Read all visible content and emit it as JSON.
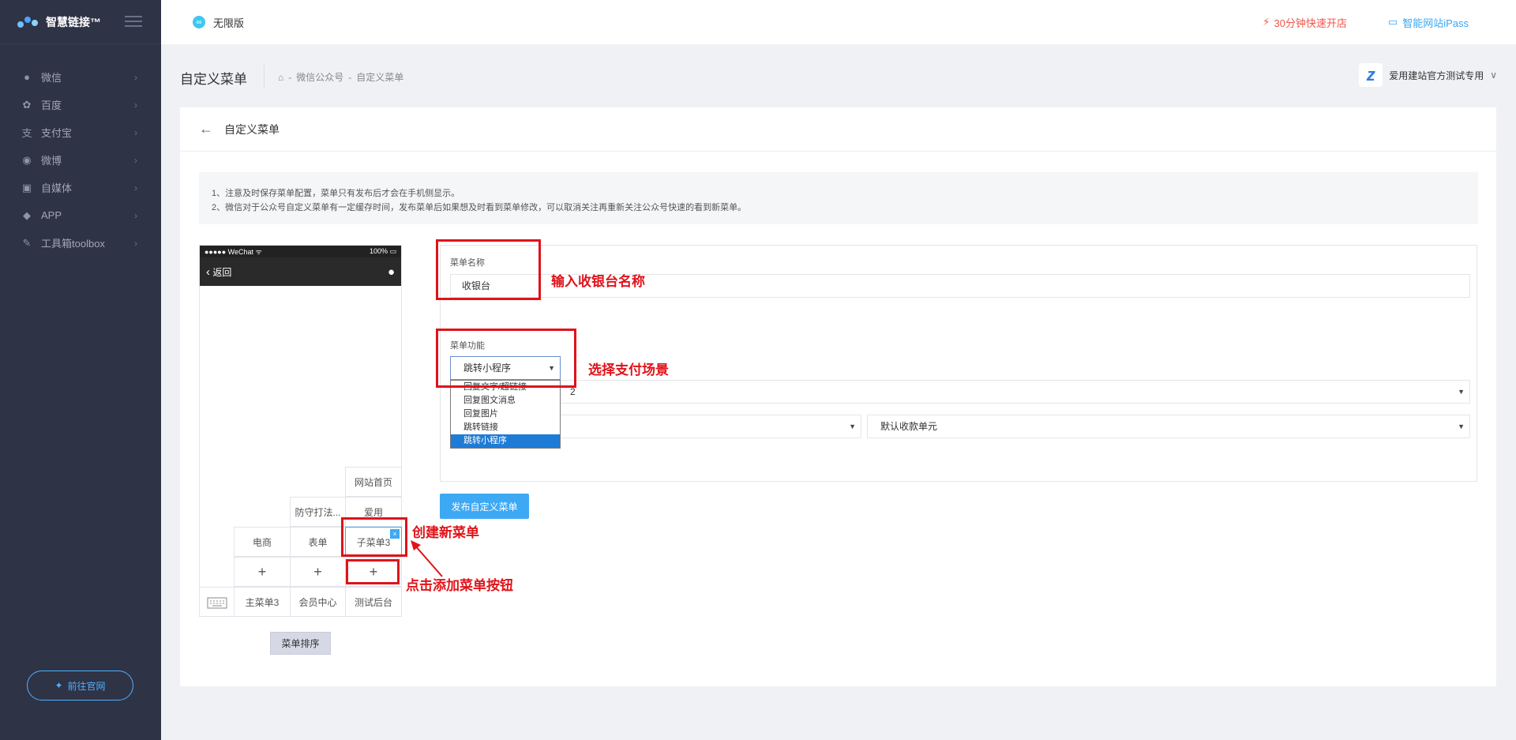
{
  "sidebar": {
    "logo_text": "智慧链接™",
    "items": [
      {
        "label": "微信",
        "icon": "wechat-icon",
        "glyph": "●"
      },
      {
        "label": "百度",
        "icon": "paw-icon",
        "glyph": "✿"
      },
      {
        "label": "支付宝",
        "icon": "alipay-icon",
        "glyph": "支"
      },
      {
        "label": "微博",
        "icon": "weibo-icon",
        "glyph": "◉"
      },
      {
        "label": "自媒体",
        "icon": "media-icon",
        "glyph": "▣"
      },
      {
        "label": "APP",
        "icon": "android-icon",
        "glyph": "◆"
      },
      {
        "label": "工具箱toolbox",
        "icon": "wrench-icon",
        "glyph": "✎"
      }
    ],
    "official_btn": "前往官网"
  },
  "topbar": {
    "edition": "无限版",
    "quick_open": "30分钟快速开店",
    "ipass": "智能网站iPass"
  },
  "header": {
    "title": "自定义菜单",
    "breadcrumb": [
      "微信公众号",
      "自定义菜单"
    ],
    "breadcrumb_sep": "-",
    "account": "爱用建站官方测试专用"
  },
  "card": {
    "title": "自定义菜单",
    "notice": [
      "1、注意及时保存菜单配置，菜单只有发布后才会在手机侧显示。",
      "2、微信对于公众号自定义菜单有一定缓存时间，发布菜单后如果想及时看到菜单修改，可以取消关注再重新关注公众号快速的看到新菜单。"
    ]
  },
  "phone": {
    "status_left": "●●●●● WeChat ᯤ",
    "status_right": "100%",
    "back": "返回",
    "sub_menus": [
      "网站首页",
      "防守打法...",
      "爱用",
      "电商",
      "表单",
      "子菜单3"
    ],
    "plus": "+",
    "main_menus": [
      "主菜单3",
      "会员中心",
      "测试后台"
    ],
    "sort_btn": "菜单排序"
  },
  "form": {
    "name_label": "菜单名称",
    "name_value": "收银台",
    "func_label": "菜单功能",
    "func_value": "跳转小程序",
    "func_options": [
      "回复文字/超链接",
      "回复图文消息",
      "回复图片",
      "跳转链接",
      "跳转小程序"
    ],
    "select2_value": "2",
    "select4_value": "默认收款单元",
    "publish": "发布自定义菜单"
  },
  "annotations": {
    "name": "输入收银台名称",
    "scene": "选择支付场景",
    "create": "创建新菜单",
    "add": "点击添加菜单按钮",
    "color": "#e0131a"
  }
}
